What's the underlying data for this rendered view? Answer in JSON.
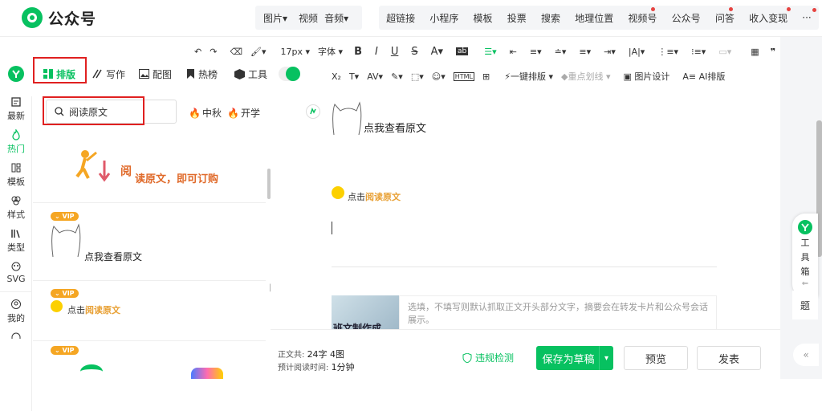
{
  "app": {
    "title": "公众号"
  },
  "top_menu": {
    "group1": [
      "图片",
      "视频",
      "音频"
    ],
    "group2": [
      "超链接",
      "小程序",
      "模板",
      "投票",
      "搜索",
      "地理位置",
      "视频号",
      "公众号",
      "问答",
      "收入变现"
    ],
    "more": "···"
  },
  "toolbar": {
    "font_size": "17px",
    "font_family": "字体",
    "one_click": "一键排版",
    "highlight": "重点划线",
    "image_design": "图片设计",
    "ai_layout": "AI排版"
  },
  "tabs": [
    "排版",
    "写作",
    "配图",
    "热榜",
    "工具"
  ],
  "rail": [
    "最新",
    "热门",
    "模板",
    "样式",
    "类型",
    "SVG",
    "我的"
  ],
  "panel": {
    "search_value": "阅读原文",
    "tags": [
      "中秋",
      "开学"
    ],
    "item1": {
      "big": "阅",
      "text": "读原文，即可订购"
    },
    "vip": "VIP",
    "item2": {
      "text": "点我查看原文"
    },
    "item3": {
      "prefix": "点击",
      "link": "阅读原文"
    }
  },
  "editor": {
    "text1": "点我查看原文",
    "text2_prefix": "点击",
    "text2_link": "阅读原文",
    "summary_placeholder": "选填，不填写则默认抓取正文开头部分文字，摘要会在转发卡片和公众号会话展示。",
    "cover_text": "班文制作成"
  },
  "footer": {
    "word_count_label": "正文共:",
    "word_count": "24字 4图",
    "read_time_label": "预计阅读时间:",
    "read_time": "1分钟",
    "check": "违规检测",
    "save": "保存为草稿",
    "preview": "预览",
    "publish": "发表"
  },
  "side": {
    "toolbox": [
      "工",
      "具",
      "箱"
    ],
    "question": "题"
  },
  "colors": {
    "brand": "#07c160",
    "red_box": "#e02020",
    "orange": "#e8a034",
    "vip": "#f5a623"
  }
}
